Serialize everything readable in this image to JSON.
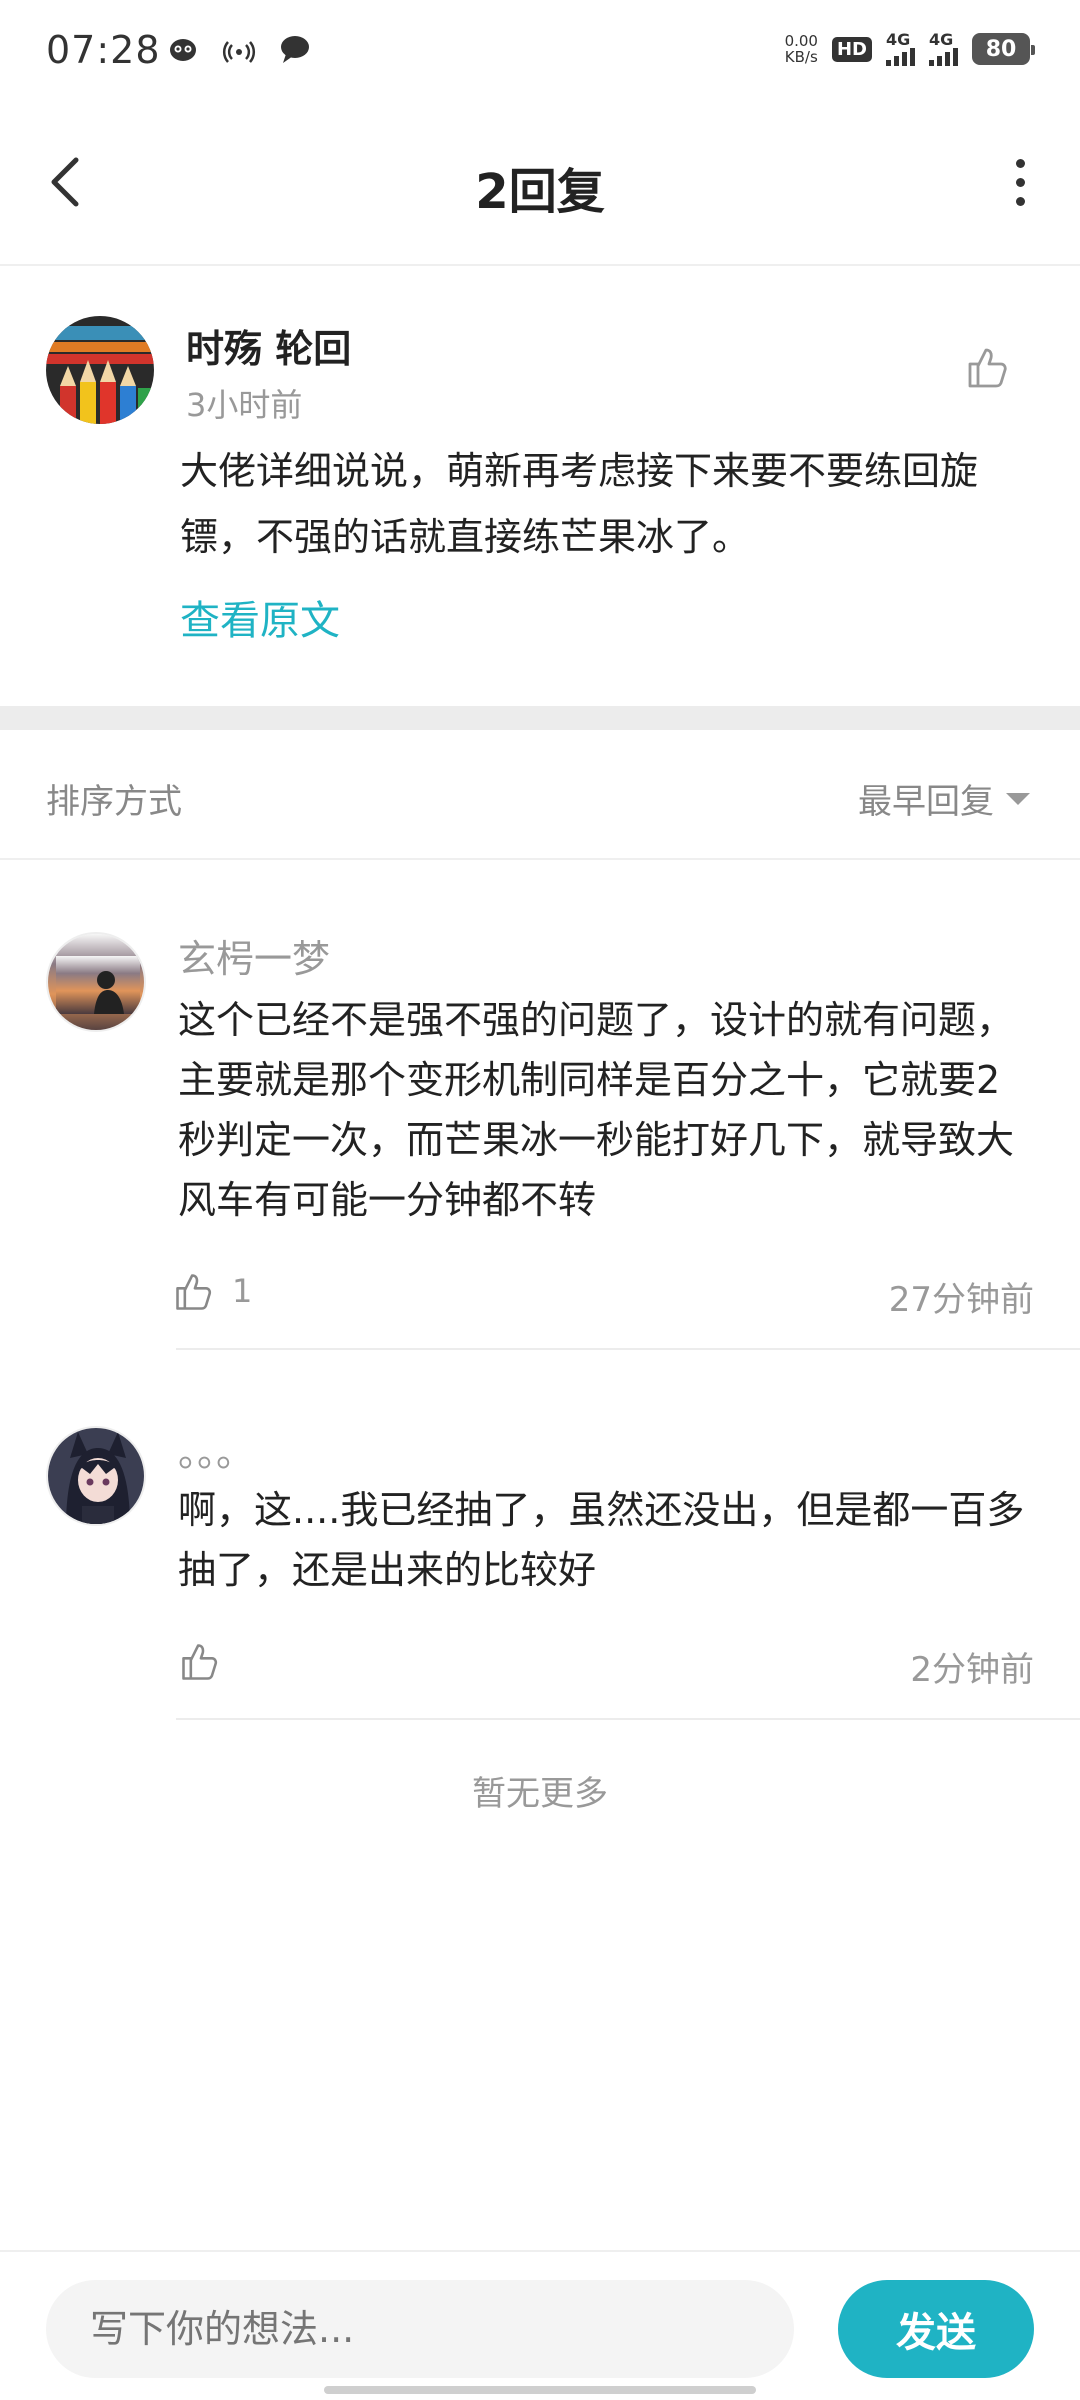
{
  "status_bar": {
    "time": "07:28",
    "speed_top": "0.00",
    "speed_unit": "KB/s",
    "hd": "HD",
    "sim1": "4G",
    "sim2": "4G",
    "battery": "80"
  },
  "nav": {
    "title": "2回复"
  },
  "post": {
    "author": "时殇 轮回",
    "time": "3小时前",
    "content": "大佬详细说说，萌新再考虑接下来要不要练回旋镖，不强的话就直接练芒果冰了。",
    "view_original": "查看原文"
  },
  "sort": {
    "label": "排序方式",
    "selected": "最早回复"
  },
  "replies": [
    {
      "name": "玄枵一梦",
      "text": "这个已经不是强不强的问题了，设计的就有问题，主要就是那个变形机制同样是百分之十，它就要2秒判定一次，而芒果冰一秒能打好几下，就导致大风车有可能一分钟都不转",
      "likes": "1",
      "time": "27分钟前"
    },
    {
      "name": "。。。",
      "text": "啊，这....我已经抽了，虽然还没出，但是都一百多抽了，还是出来的比较好",
      "likes": "",
      "time": "2分钟前"
    }
  ],
  "footer": {
    "no_more": "暂无更多"
  },
  "composer": {
    "placeholder": "写下你的想法...",
    "send_label": "发送"
  },
  "colors": {
    "accent": "#1fb3c4"
  }
}
